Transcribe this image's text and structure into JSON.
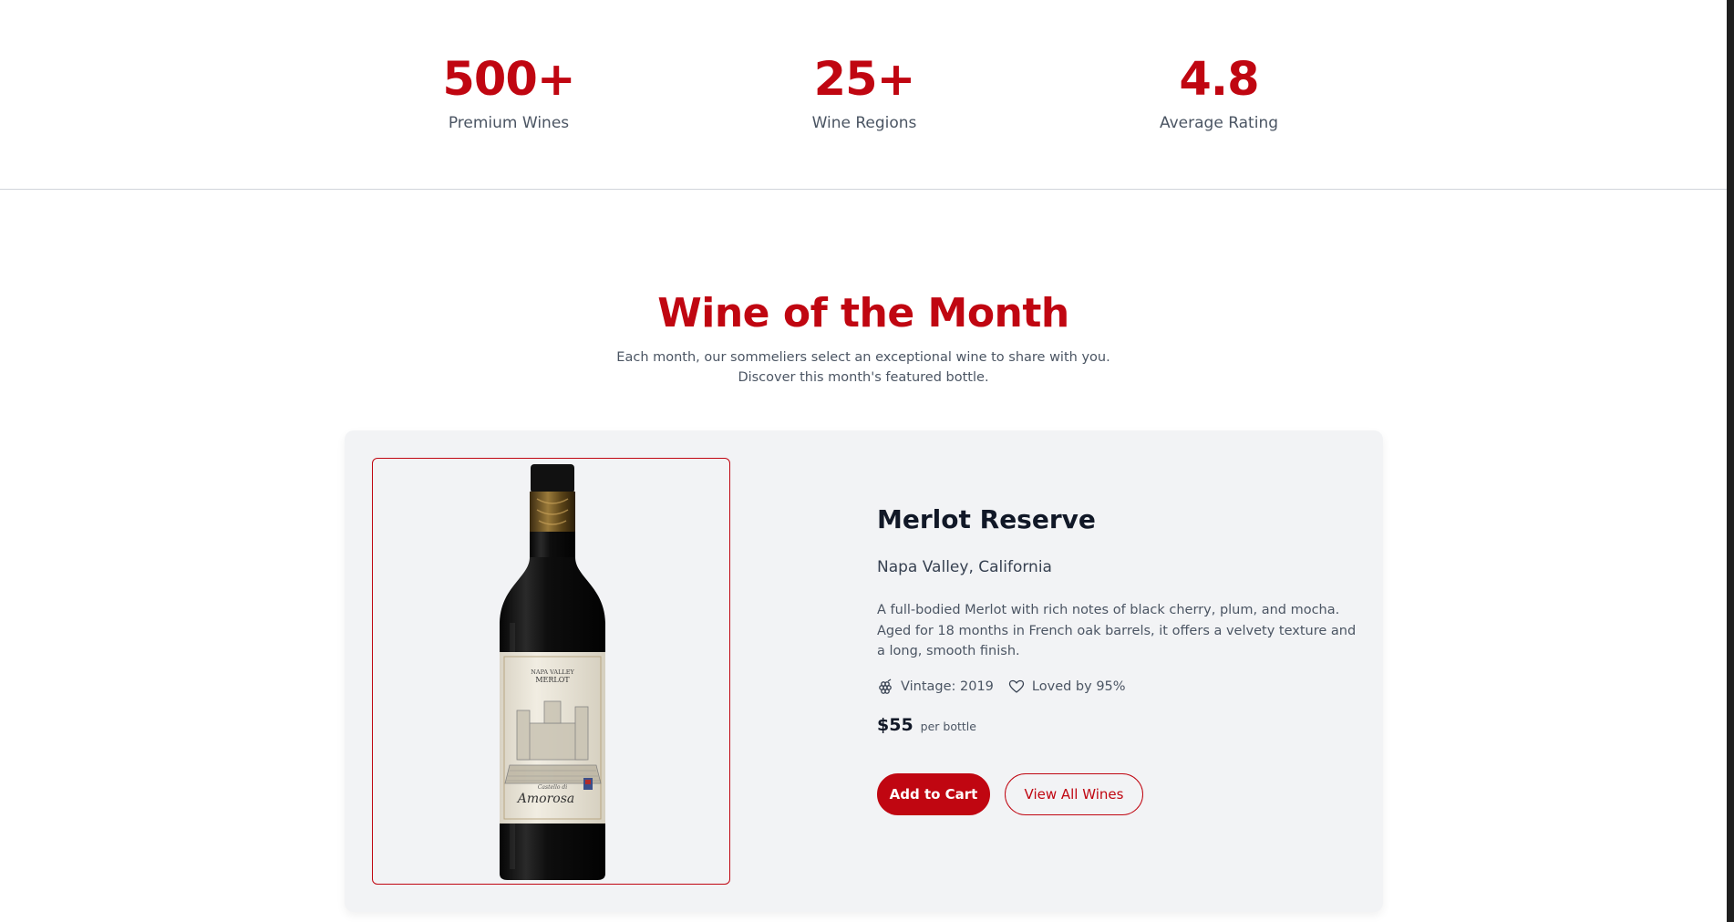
{
  "stats": [
    {
      "value": "500+",
      "label": "Premium Wines"
    },
    {
      "value": "25+",
      "label": "Wine Regions"
    },
    {
      "value": "4.8",
      "label": "Average Rating"
    }
  ],
  "wine_of_month": {
    "title": "Wine of the Month",
    "subtitle_line1": "Each month, our sommeliers select an exceptional wine to share with you.",
    "subtitle_line2": "Discover this month's featured bottle."
  },
  "wine": {
    "name": "Merlot Reserve",
    "region": "Napa Valley, California",
    "description": "A full-bodied Merlot with rich notes of black cherry, plum, and mocha. Aged for 18 months in French oak barrels, it offers a velvety texture and a long, smooth finish.",
    "vintage": "Vintage: 2019",
    "loved": "Loved by 95%",
    "price": "$55",
    "price_unit": "per bottle",
    "label_line1": "NAPA VALLEY",
    "label_line2": "MERLOT",
    "label_brand_1": "Castello di",
    "label_brand_2": "Amorosa"
  },
  "buttons": {
    "add_to_cart": "Add to Cart",
    "view_all": "View All Wines"
  },
  "colors": {
    "accent": "#c00611",
    "card_bg": "#f2f3f5",
    "text_dark": "#111827",
    "text_muted": "#4b5563"
  },
  "icons": {
    "vintage": "grape-icon",
    "loved": "heart-icon"
  }
}
